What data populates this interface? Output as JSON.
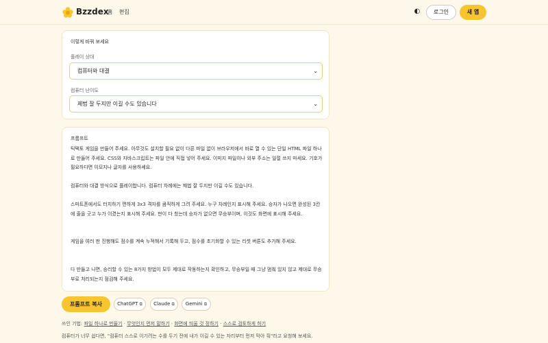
{
  "header": {
    "brand": "Bzzdex",
    "nav": [
      "홈",
      "편집"
    ],
    "theme_icon": "◐",
    "login_label": "로그인",
    "new_app_label": "새 앱",
    "accent_color": "#f7c62f"
  },
  "settings": {
    "title": "이렇게 바꿔 보세요",
    "play_label": "플레이 상대",
    "play_value": "컴퓨터와 대결",
    "level_label": "컴퓨터 난이도",
    "level_value": "제법 잘 두지만 이길 수도 있습니다"
  },
  "prompt": {
    "title": "프롬프트",
    "paragraphs": [
      "틱택토 게임을 만들어 주세요. 아무것도 설치할 필요 없이 다른 파일 없이 브라우저에서 바로 열 수 있는 단일 HTML 파일 하나로 만들어 주세요. CSS와 자바스크립트는 파일 안에 직접 넣어 주세요. 이미지 파일이나 외부 주소는 일절 쓰지 마세요. 기호가 필요하다면 이모지나 글자를 사용하세요.",
      "컴퓨터와 대결 방식으로 플레이합니다. 컴퓨터 차례에는 제법 잘 두지만 이길 수도 있습니다.",
      "스마트폰에서도 터치하기 편하게 3x3 격자를 큼직하게 그려 주세요. 누구 차례인지 표시해 주세요. 승자가 나오면 완성된 3칸에 줄을 긋고 누가 이겼는지 표시해 주세요. 판이 다 찼는데 승자가 없으면 무승부이며, 이것도 화면에 표시해 주세요.",
      "게임을 여러 판 진행해도 점수를 계속 누적해서 기록해 두고, 점수를 초기화할 수 있는 리셋 버튼도 추가해 주세요.",
      "다 만들고 나면, 승리할 수 있는 8가지 방법이 모두 제대로 작동하는지 확인하고, 무승부일 때 그냥 멈춰 있지 않고 제대로 무승부로 처리되는지 점검해 주세요."
    ]
  },
  "actions": {
    "copy_label": "프롬프트 복사",
    "ext": [
      "ChatGPT",
      "Claude",
      "Gemini"
    ],
    "ext_icon": "⧉"
  },
  "tips": {
    "prefix": "쓰인 기법: ",
    "links": [
      "파일 하나로 만들기",
      "무엇인지 먼저 말하기",
      "화면에 띄울 것 정하기",
      "스스로 검토하게 하기"
    ],
    "separator": " · "
  },
  "footnote": "컴퓨터가 너무 쉽다면, \"컴퓨터 스스로 이기려는 수를 두기 전에 내가 이길 수 있는 자리부터 먼저 막아 줘\"라고 요청해 보세요."
}
